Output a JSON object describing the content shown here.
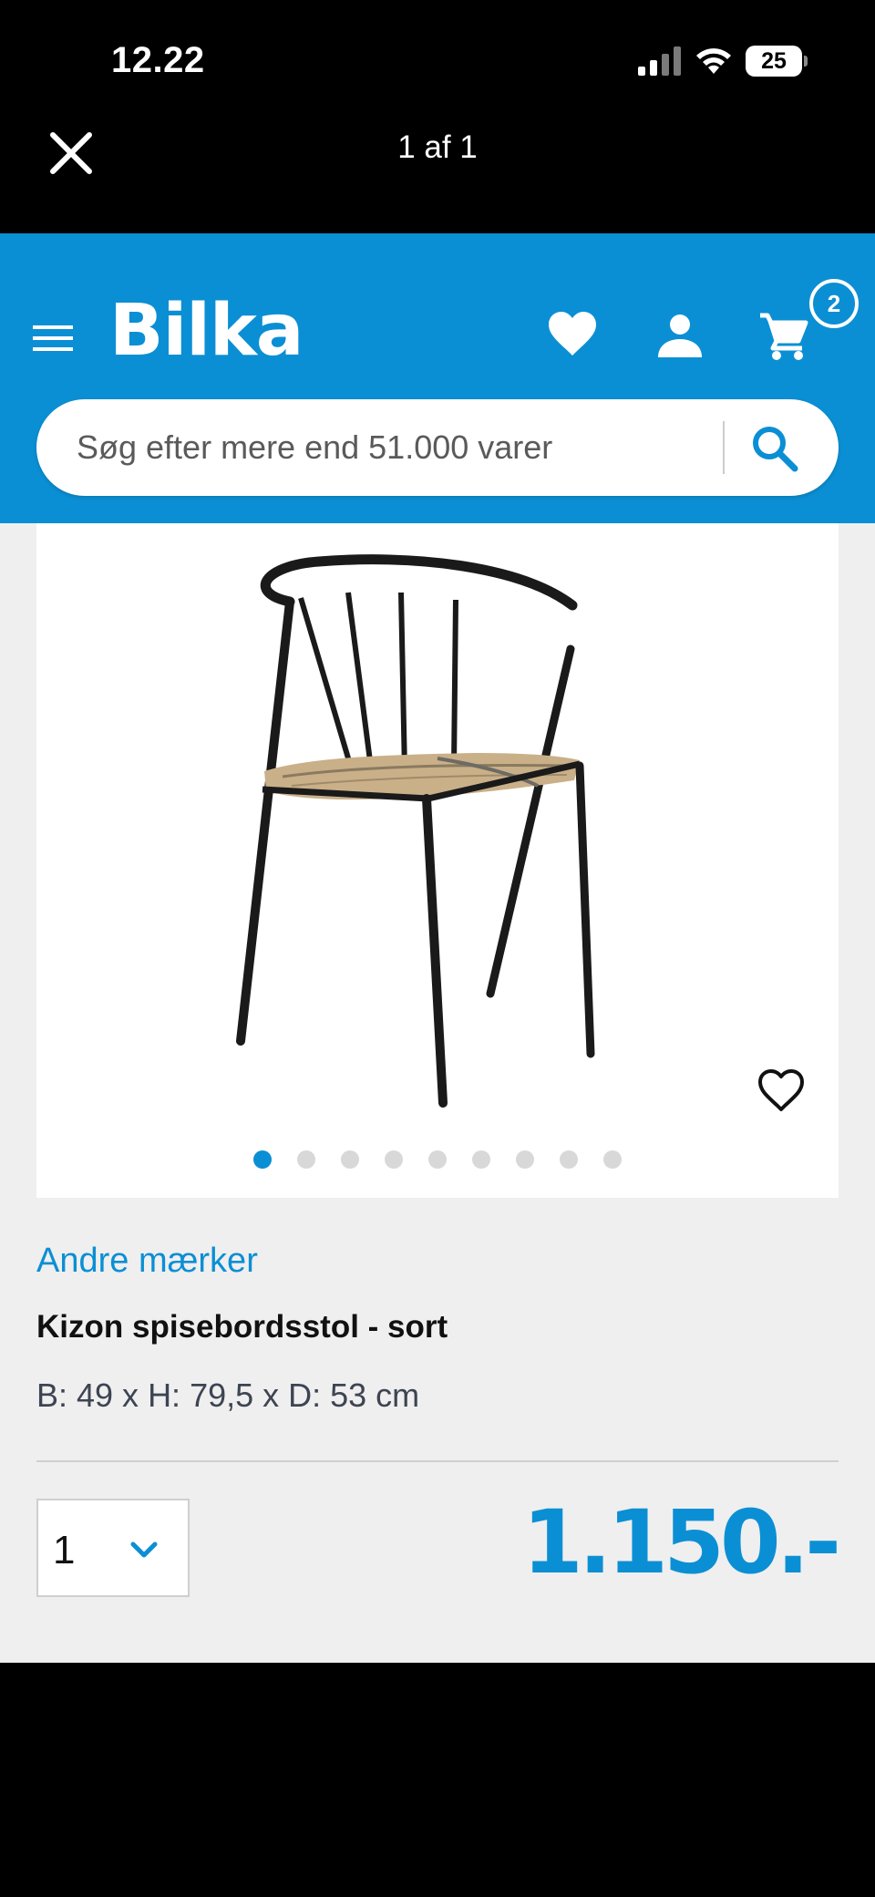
{
  "status_bar": {
    "time": "12.22",
    "battery": "25"
  },
  "viewer": {
    "title": "1 af 1"
  },
  "header": {
    "logo": "Bilka",
    "cart_count": "2",
    "search_placeholder": "Søg efter mere end 51.000 varer"
  },
  "product": {
    "brand": "Andre mærker",
    "title": "Kizon spisebordsstol - sort",
    "dimensions": "B: 49 x H: 79,5 x D: 53 cm",
    "price": "1.150.-",
    "quantity": "1",
    "image_count": 9,
    "active_image_index": 0
  },
  "colors": {
    "brand_blue": "#0b8fd4",
    "background": "#efefef",
    "text_dark": "#111111"
  },
  "icons": {
    "close": "close-icon",
    "menu": "hamburger-menu-icon",
    "wishlist": "heart-icon",
    "account": "user-icon",
    "cart": "shopping-cart-icon",
    "search": "search-icon",
    "favorite": "heart-outline-icon",
    "dropdown": "chevron-down-icon"
  }
}
